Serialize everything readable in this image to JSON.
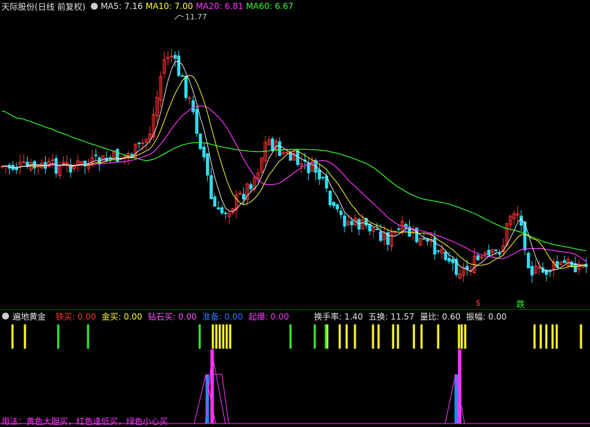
{
  "header": {
    "stock_title": "天际股份(日线 前复权)",
    "ma": [
      {
        "label": "MA5: 7.16",
        "color": "#e6e6e6"
      },
      {
        "label": "MA10: 7.00",
        "color": "#ffff33"
      },
      {
        "label": "MA20: 6.81",
        "color": "#ff33ff"
      },
      {
        "label": "MA60: 6.67",
        "color": "#33ff33"
      }
    ]
  },
  "chart_data": {
    "type": "candlestick",
    "peak_label": "11.77",
    "colors": {
      "up": "#ff3333",
      "down": "#33ddee",
      "ma5": "#e6e6e6",
      "ma10": "#ffff33",
      "ma20": "#ff33ff",
      "ma60": "#33ff33"
    },
    "signal_marks": [
      {
        "text": "$",
        "color": "#ff3333"
      },
      {
        "text": "跌",
        "color": "#33ff33"
      }
    ]
  },
  "indicator": {
    "name": "遍地黄金",
    "fields": [
      {
        "label": "铁买: 0.00",
        "color": "#ff3333"
      },
      {
        "label": "金买: 0.00",
        "color": "#ffff33"
      },
      {
        "label": "钻石买: 0.00",
        "color": "#ff55ff"
      },
      {
        "label": "准备: 0.00",
        "color": "#3377ff"
      },
      {
        "label": "起爆: 0.00",
        "color": "#ff33ff"
      },
      {
        "label": "换手率: 1.40",
        "color": "#e6e6e6"
      },
      {
        "label": "五换: 11.57",
        "color": "#e6e6e6"
      },
      {
        "label": "量比: 0.60",
        "color": "#e6e6e6"
      },
      {
        "label": "振幅: 0.00",
        "color": "#e6e6e6"
      }
    ],
    "usage_text": "用法：黄色大胆买，红色逢低买，绿色小心买"
  }
}
